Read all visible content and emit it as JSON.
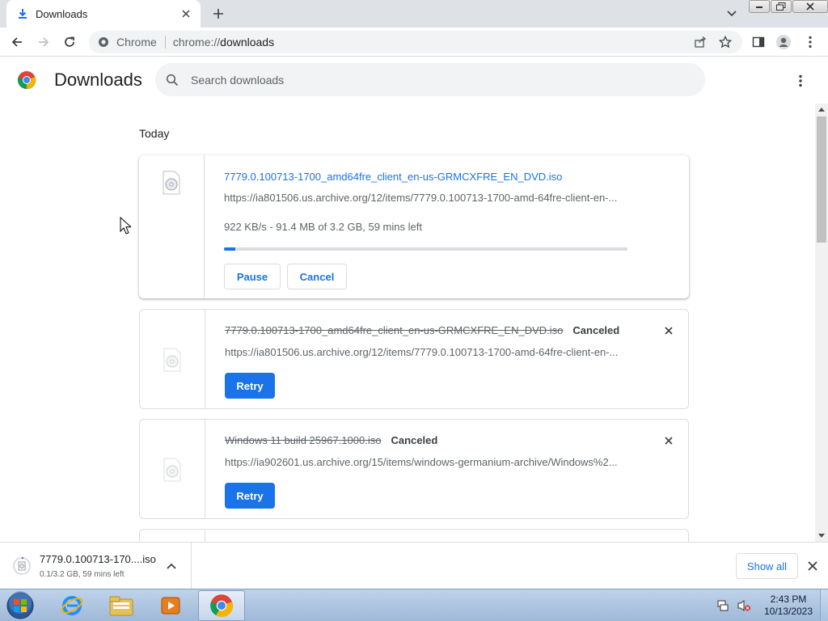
{
  "tab": {
    "title": "Downloads",
    "icon": "download-icon"
  },
  "omnibox": {
    "site_name": "Chrome",
    "url_scheme": "chrome://",
    "url_host": "downloads"
  },
  "page": {
    "title": "Downloads",
    "search_placeholder": "Search downloads",
    "date_label": "Today"
  },
  "downloads": [
    {
      "filename": "7779.0.100713-1700_amd64fre_client_en-us-GRMCXFRE_EN_DVD.iso",
      "url": "https://ia801506.us.archive.org/12/items/7779.0.100713-1700-amd-64fre-client-en-...",
      "progress_text": "922 KB/s - 91.4 MB of 3.2 GB, 59 mins left",
      "progress_fraction": 0.028,
      "pause_label": "Pause",
      "cancel_label": "Cancel",
      "state": "in_progress"
    },
    {
      "filename": "7779.0.100713-1700_amd64fre_client_en-us-GRMCXFRE_EN_DVD.iso",
      "status": "Canceled",
      "url": "https://ia801506.us.archive.org/12/items/7779.0.100713-1700-amd-64fre-client-en-...",
      "retry_label": "Retry",
      "state": "canceled"
    },
    {
      "filename": "Windows 11 build 25967.1000.iso",
      "status": "Canceled",
      "url": "https://ia902601.us.archive.org/15/items/windows-germanium-archive/Windows%2...",
      "retry_label": "Retry",
      "state": "canceled"
    }
  ],
  "shelf": {
    "item_name": "7779.0.100713-170....iso",
    "item_status": "0.1/3.2 GB, 59 mins left",
    "show_all_label": "Show all"
  },
  "taskbar": {
    "apps": [
      "internet-explorer",
      "windows-explorer",
      "media-player",
      "google-chrome"
    ],
    "time": "2:43 PM",
    "date": "10/13/2023"
  },
  "colors": {
    "accent": "#1a73e8",
    "titlebar": "#dee1e6",
    "muted": "#5f6368"
  }
}
